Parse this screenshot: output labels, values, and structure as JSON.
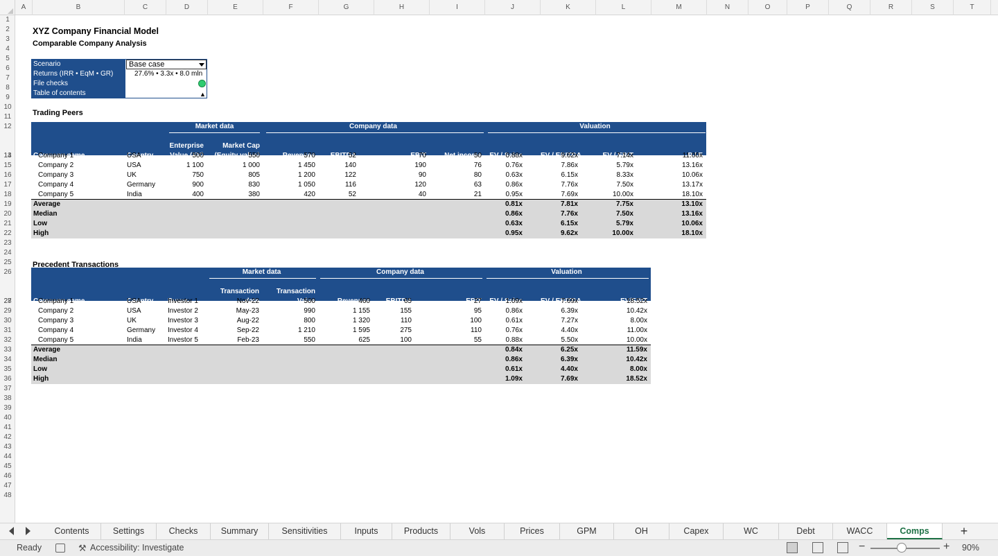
{
  "columns": [
    "A",
    "B",
    "C",
    "D",
    "E",
    "F",
    "G",
    "H",
    "I",
    "J",
    "K",
    "L",
    "M",
    "N",
    "O",
    "P",
    "Q",
    "R",
    "S",
    "T"
  ],
  "rows": [
    "1",
    "2",
    "3",
    "4",
    "5",
    "6",
    "7",
    "8",
    "9",
    "10",
    "11",
    "12",
    "13",
    "14",
    "15",
    "16",
    "17",
    "18",
    "19",
    "20",
    "21",
    "22",
    "23",
    "24",
    "25",
    "26",
    "27",
    "28",
    "29",
    "30",
    "31",
    "32",
    "33",
    "34",
    "35",
    "36",
    "37",
    "38",
    "39",
    "40",
    "41",
    "42",
    "43",
    "44",
    "45",
    "46",
    "47",
    "48"
  ],
  "header": {
    "title": "XYZ Company Financial Model",
    "subtitle": "Comparable Company Analysis"
  },
  "scenario_box": {
    "scenario_label": "Scenario",
    "scenario_value": "Base case",
    "returns_label": "Returns (IRR • EqM • GR)",
    "returns_value": "27.6% • 3.3x • 8.0 mln",
    "file_checks_label": "File checks",
    "file_checks_status_color": "#2ecc71",
    "toc_label": "Table of contents",
    "toc_symbol": "▲"
  },
  "trading_peers": {
    "section_title": "Trading Peers",
    "groups": {
      "market": "Market data",
      "company": "Company data",
      "valuation": "Valuation"
    },
    "headers": {
      "company": "Company name",
      "country": "Country",
      "ev_1": "Enterprise",
      "ev_2": "Value (EV)",
      "mcap_1": "Market Cap",
      "mcap_2": "(Equity value)",
      "revenues": "Revenues",
      "ebitda": "EBITDA",
      "ebit": "EBIT",
      "net_income": "Net income",
      "ev_sales": "EV / Sales",
      "ev_ebitda": "EV / EBITDA",
      "ev_ebit": "EV / EBIT",
      "pe": "P / E"
    },
    "rows": [
      {
        "company": "Company 1",
        "country": "USA",
        "ev": "500",
        "mcap": "550",
        "revenues": "570",
        "ebitda": "52",
        "ebit": "70",
        "net_income": "50",
        "ev_sales": "0.88x",
        "ev_ebitda": "9.62x",
        "ev_ebit": "7.14x",
        "pe": "11.00x"
      },
      {
        "company": "Company 2",
        "country": "USA",
        "ev": "1 100",
        "mcap": "1 000",
        "revenues": "1 450",
        "ebitda": "140",
        "ebit": "190",
        "net_income": "76",
        "ev_sales": "0.76x",
        "ev_ebitda": "7.86x",
        "ev_ebit": "5.79x",
        "pe": "13.16x"
      },
      {
        "company": "Company 3",
        "country": "UK",
        "ev": "750",
        "mcap": "805",
        "revenues": "1 200",
        "ebitda": "122",
        "ebit": "90",
        "net_income": "80",
        "ev_sales": "0.63x",
        "ev_ebitda": "6.15x",
        "ev_ebit": "8.33x",
        "pe": "10.06x"
      },
      {
        "company": "Company 4",
        "country": "Germany",
        "ev": "900",
        "mcap": "830",
        "revenues": "1 050",
        "ebitda": "116",
        "ebit": "120",
        "net_income": "63",
        "ev_sales": "0.86x",
        "ev_ebitda": "7.76x",
        "ev_ebit": "7.50x",
        "pe": "13.17x"
      },
      {
        "company": "Company 5",
        "country": "India",
        "ev": "400",
        "mcap": "380",
        "revenues": "420",
        "ebitda": "52",
        "ebit": "40",
        "net_income": "21",
        "ev_sales": "0.95x",
        "ev_ebitda": "7.69x",
        "ev_ebit": "10.00x",
        "pe": "18.10x"
      }
    ],
    "stats": [
      {
        "label": "Average",
        "ev_sales": "0.81x",
        "ev_ebitda": "7.81x",
        "ev_ebit": "7.75x",
        "pe": "13.10x"
      },
      {
        "label": "Median",
        "ev_sales": "0.86x",
        "ev_ebitda": "7.76x",
        "ev_ebit": "7.50x",
        "pe": "13.16x"
      },
      {
        "label": "Low",
        "ev_sales": "0.63x",
        "ev_ebitda": "6.15x",
        "ev_ebit": "5.79x",
        "pe": "10.06x"
      },
      {
        "label": "High",
        "ev_sales": "0.95x",
        "ev_ebitda": "9.62x",
        "ev_ebit": "10.00x",
        "pe": "18.10x"
      }
    ]
  },
  "precedent_transactions": {
    "section_title": "Precedent Transactions",
    "groups": {
      "market": "Market data",
      "company": "Company data",
      "valuation": "Valuation"
    },
    "headers": {
      "company": "Company name",
      "country": "Country",
      "buyer": "Buyer",
      "date_1": "Transaction",
      "date_2": "date",
      "value_1": "Transaction",
      "value_2": "Value",
      "revenues": "Revenues",
      "ebitda": "EBITDA",
      "ebit": "EBIT",
      "ev_sales": "EV / Sales",
      "ev_ebitda": "EV / EBITDA",
      "ev_ebit": "EV/EBIT"
    },
    "rows": [
      {
        "company": "Company 1",
        "country": "USA",
        "buyer": "Investor 1",
        "date": "Nov-22",
        "value": "500",
        "revenues": "460",
        "ebitda": "65",
        "ebit": "27",
        "ev_sales": "1.09x",
        "ev_ebitda": "7.69x",
        "ev_ebit": "18.52x"
      },
      {
        "company": "Company 2",
        "country": "USA",
        "buyer": "Investor 2",
        "date": "May-23",
        "value": "990",
        "revenues": "1 155",
        "ebitda": "155",
        "ebit": "95",
        "ev_sales": "0.86x",
        "ev_ebitda": "6.39x",
        "ev_ebit": "10.42x"
      },
      {
        "company": "Company 3",
        "country": "UK",
        "buyer": "Investor 3",
        "date": "Aug-22",
        "value": "800",
        "revenues": "1 320",
        "ebitda": "110",
        "ebit": "100",
        "ev_sales": "0.61x",
        "ev_ebitda": "7.27x",
        "ev_ebit": "8.00x"
      },
      {
        "company": "Company 4",
        "country": "Germany",
        "buyer": "Investor 4",
        "date": "Sep-22",
        "value": "1 210",
        "revenues": "1 595",
        "ebitda": "275",
        "ebit": "110",
        "ev_sales": "0.76x",
        "ev_ebitda": "4.40x",
        "ev_ebit": "11.00x"
      },
      {
        "company": "Company 5",
        "country": "India",
        "buyer": "Investor 5",
        "date": "Feb-23",
        "value": "550",
        "revenues": "625",
        "ebitda": "100",
        "ebit": "55",
        "ev_sales": "0.88x",
        "ev_ebitda": "5.50x",
        "ev_ebit": "10.00x"
      }
    ],
    "stats": [
      {
        "label": "Average",
        "ev_sales": "0.84x",
        "ev_ebitda": "6.25x",
        "ev_ebit": "11.59x"
      },
      {
        "label": "Median",
        "ev_sales": "0.86x",
        "ev_ebitda": "6.39x",
        "ev_ebit": "10.42x"
      },
      {
        "label": "Low",
        "ev_sales": "0.61x",
        "ev_ebitda": "4.40x",
        "ev_ebit": "8.00x"
      },
      {
        "label": "High",
        "ev_sales": "1.09x",
        "ev_ebitda": "7.69x",
        "ev_ebit": "18.52x"
      }
    ]
  },
  "tabs": [
    {
      "label": "Contents"
    },
    {
      "label": "Settings"
    },
    {
      "label": "Checks"
    },
    {
      "label": "Summary"
    },
    {
      "label": "Sensitivities"
    },
    {
      "label": "Inputs"
    },
    {
      "label": "Products"
    },
    {
      "label": "Vols"
    },
    {
      "label": "Prices"
    },
    {
      "label": "GPM"
    },
    {
      "label": "OH"
    },
    {
      "label": "Capex"
    },
    {
      "label": "WC"
    },
    {
      "label": "Debt"
    },
    {
      "label": "WACC"
    },
    {
      "label": "Comps"
    }
  ],
  "active_tab": "Comps",
  "colors": {
    "header_navy": "#1f4e8c",
    "stats_grey": "#d9d9d9",
    "active_tab_green": "#1e7145"
  },
  "statusbar": {
    "ready": "Ready",
    "accessibility": "Accessibility: Investigate",
    "zoom": "90%",
    "zoom_value_percent": 90
  }
}
